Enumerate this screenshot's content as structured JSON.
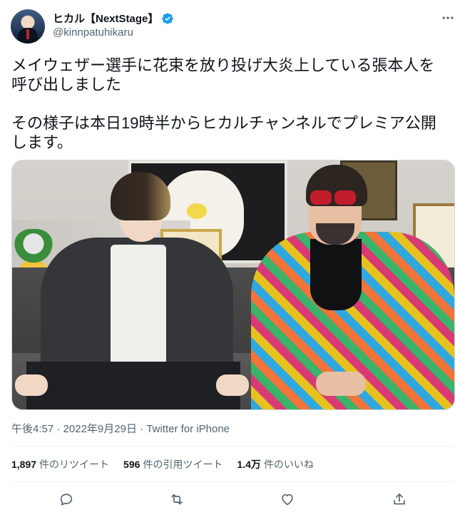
{
  "author": {
    "display_name": "ヒカル【NextStage】",
    "handle": "@kinnpatuhikaru",
    "verified": true
  },
  "tweet": {
    "text": "メイウェザー選手に花束を放り投げ大炎上している張本人を\n呼び出しました\n\nその様子は本日19時半からヒカルチャンネルでプレミア公開\nします。"
  },
  "media": {
    "type": "photo"
  },
  "meta": {
    "time": "午後4:57",
    "separator1": " · ",
    "date": "2022年9月29日",
    "separator2": " · ",
    "source": "Twitter for iPhone"
  },
  "stats": {
    "retweets": {
      "count": "1,897",
      "label": "件のリツイート"
    },
    "quotes": {
      "count": "596",
      "label": "件の引用ツイート"
    },
    "likes": {
      "count": "1.4万",
      "label": "件のいいね"
    }
  },
  "icons": {
    "more": "more-icon",
    "verified": "verified-badge-icon",
    "reply": "reply-icon",
    "retweet": "retweet-icon",
    "like": "heart-icon",
    "share": "share-icon"
  },
  "colors": {
    "text_primary": "#0f1419",
    "text_secondary": "#536471",
    "verified_blue": "#1d9bf0",
    "divider": "#eff3f4"
  }
}
